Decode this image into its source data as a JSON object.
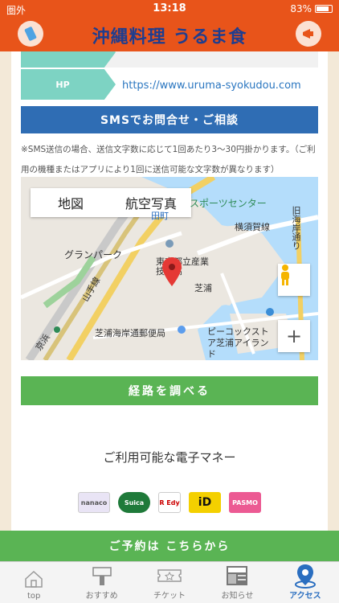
{
  "status_bar": {
    "carrier": "圏外",
    "time": "13:18",
    "battery": "83%"
  },
  "header": {
    "logo": "沖縄料理 うるま食堂",
    "left_icon": "phone-icon",
    "right_icon": "megaphone-icon"
  },
  "contact": {
    "hp_label": "HP",
    "hp_url": "https://www.uruma-syokudou.com",
    "sms_button": "SMSでお問合せ・ご相談",
    "sms_note": "※SMS送信の場合、送信文字数に応じて1回あたり3〜30円掛かります。（ご利用の機種またはアプリにより1回に送信可能な文字数が異なります）"
  },
  "map": {
    "tab_map": "地図",
    "tab_satellite": "航空写真",
    "labels": {
      "sports_center": "スポーツセンター",
      "yokosuka_line": "横須賀線",
      "granpark": "グランパーク",
      "school": "東京都立産業技術高",
      "shibaura": "芝浦",
      "yamanote": "山手線",
      "keihin": "京浜",
      "post_office": "芝浦海岸通郵便局",
      "beacon": "ピーコックストア芝浦アイランド",
      "kyu_kaigan": "旧海岸通り",
      "tamachi": "田町"
    },
    "zoom_label": "+"
  },
  "route_button": "経路を調べる",
  "emoney": {
    "title": "ご利用可能な電子マネー",
    "cards": [
      {
        "name": "nanaco",
        "label": "nanaco",
        "color": "#e9e4f5"
      },
      {
        "name": "suica",
        "label": "Suica",
        "color": "#1f7a3a"
      },
      {
        "name": "edy",
        "label": "R Edy",
        "color": "#ffffff"
      },
      {
        "name": "id",
        "label": "iD",
        "color": "#f4d000"
      },
      {
        "name": "pasmo",
        "label": "PASMO",
        "color": "#ec5a93"
      }
    ]
  },
  "reserve_button": "ご予約は こちらから",
  "tabbar": [
    {
      "label": "top",
      "icon": "home-icon",
      "active": false
    },
    {
      "label": "おすすめ",
      "icon": "recommend-icon",
      "active": false
    },
    {
      "label": "チケット",
      "icon": "ticket-icon",
      "active": false
    },
    {
      "label": "お知らせ",
      "icon": "news-icon",
      "active": false
    },
    {
      "label": "アクセス",
      "icon": "map-pin-icon",
      "active": true
    }
  ],
  "colors": {
    "brand": "#e8541a",
    "accent_blue": "#2f6db4",
    "green": "#5ab454",
    "teal": "#7dd3c3"
  }
}
